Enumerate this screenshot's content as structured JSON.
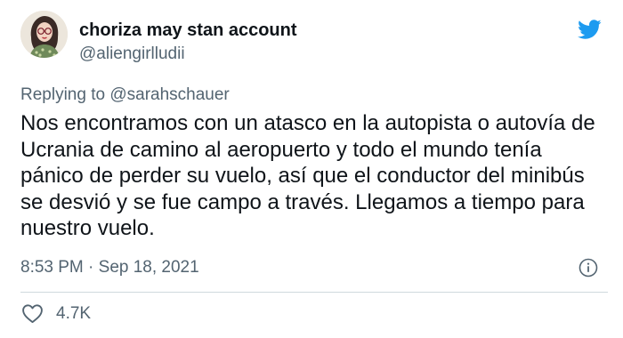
{
  "author": {
    "display_name": "choriza may stan account",
    "handle": "@aliengirlludii"
  },
  "reply": {
    "prefix": "Replying to ",
    "mention": "@sarahschauer"
  },
  "tweet": {
    "text": "Nos encontramos con un atasco en la autopista o autovía de Ucrania de camino al aeropuerto y todo el mundo tenía pánico de perder su vuelo, así que el conductor del minibús se desvió y se fue campo a través. Llegamos a tiempo para nuestro vuelo.",
    "timestamp": "8:53 PM · Sep 18, 2021"
  },
  "stats": {
    "likes": "4.7K"
  },
  "icons": {
    "brand": "twitter-bird-icon",
    "info": "info-icon",
    "like": "heart-icon"
  },
  "colors": {
    "brand_blue": "#1d9bf0",
    "text_primary": "#0f1419",
    "text_secondary": "#536471",
    "divider": "#cfd9de"
  }
}
